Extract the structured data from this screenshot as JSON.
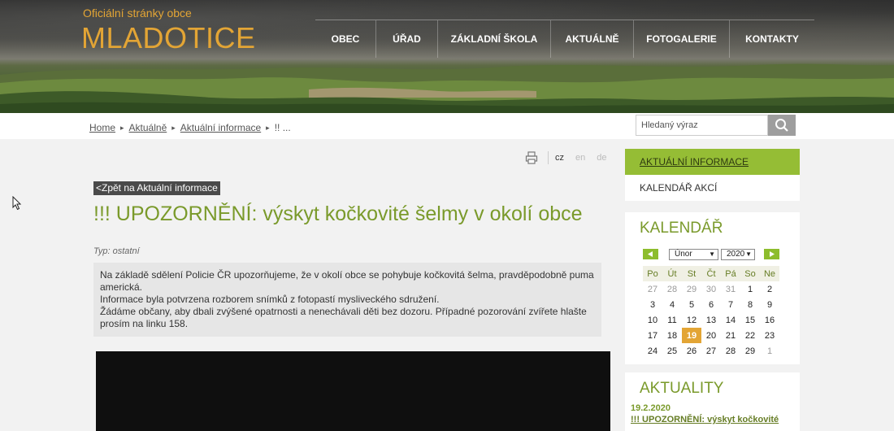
{
  "header": {
    "subtitle": "Oficiální stránky obce",
    "title": "MLADOTICE",
    "nav": [
      "OBEC",
      "ÚŘAD",
      "ZÁKLADNÍ ŠKOLA",
      "AKTUÁLNĚ",
      "FOTOGALERIE",
      "KONTAKTY"
    ]
  },
  "breadcrumb": {
    "items": [
      "Home",
      "Aktuálně",
      "Aktuální informace"
    ],
    "current": "!! ..."
  },
  "search": {
    "placeholder": "Hledaný výraz"
  },
  "tools": {
    "langs": [
      "cz",
      "en",
      "de"
    ],
    "active_lang": "cz"
  },
  "article": {
    "back_link": "<Zpět na Aktuální informace",
    "title": "!!! UPOZORNĚNÍ: výskyt kočkovité šelmy v okolí obce",
    "type": "Typ: ostatní",
    "body": [
      "Na základě sdělení Policie ČR upozorňujeme, že v okolí obce se pohybuje kočkovitá šelma, pravděpodobně puma americká.",
      "Informace byla potvrzena rozborem snímků z fotopastí mysliveckého sdružení.",
      "Žádáme občany, aby dbali zvýšené opatrnosti a nenechávali děti bez dozoru. Případné pozorování zvířete hlašte prosím na linku 158."
    ]
  },
  "sidebar": {
    "menu": [
      "AKTUÁLNÍ INFORMACE",
      "KALENDÁŘ AKCÍ"
    ],
    "calendar": {
      "title": "KALENDÁŘ",
      "month": "Únor",
      "year": "2020",
      "weekdays": [
        "Po",
        "Út",
        "St",
        "Čt",
        "Pá",
        "So",
        "Ne"
      ],
      "weeks": [
        [
          "27",
          "28",
          "29",
          "30",
          "31",
          "1",
          "2"
        ],
        [
          "3",
          "4",
          "5",
          "6",
          "7",
          "8",
          "9"
        ],
        [
          "10",
          "11",
          "12",
          "13",
          "14",
          "15",
          "16"
        ],
        [
          "17",
          "18",
          "19",
          "20",
          "21",
          "22",
          "23"
        ],
        [
          "24",
          "25",
          "26",
          "27",
          "28",
          "29",
          "1"
        ]
      ],
      "today": "19"
    },
    "news": {
      "title": "AKTUALITY",
      "date": "19.2.2020",
      "link": "!!! UPOZORNĚNÍ: výskyt kočkovité"
    }
  },
  "colors": {
    "accent_green": "#95bd35",
    "title_green": "#7a9a2b",
    "orange": "#e3a535"
  }
}
